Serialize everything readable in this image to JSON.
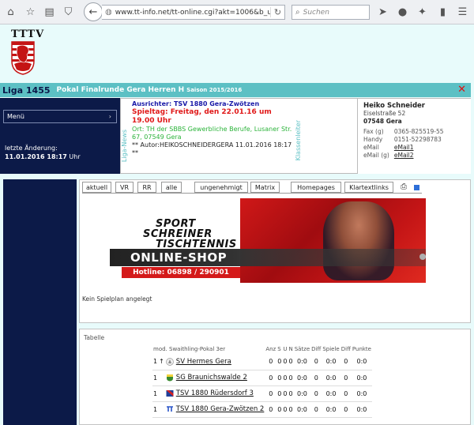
{
  "browser": {
    "url": "www.tt-info.net/tt-online.cgi?akt=1006&b_u",
    "search_placeholder": "Suchen"
  },
  "logo": {
    "text": "TTTV"
  },
  "league": {
    "number": "Liga 1455",
    "competition": "Pokal Finalrunde Gera Herren H",
    "season": "Saison 2015/2016"
  },
  "sidebar": {
    "menu_label": "Menü",
    "last_change_label": "letzte Änderung:",
    "last_change_date": "11.01.2016 18:17",
    "last_change_unit": "Uhr"
  },
  "news": {
    "vertical_label": "Liga-News",
    "ausrichter": "Ausrichter: TSV 1880 Gera-Zwötzen",
    "spieltag": "Spieltag: Freitag, den 22.01.16 um 19.00 Uhr",
    "ort": "Ort: TH der SBBS Gewerbliche Berufe, Lusaner Str. 67, 07549 Gera",
    "autor": "** Autor:HEIKOSCHNEIDERGERA 11.01.2016 18:17 **"
  },
  "contact": {
    "vertical_label": "Klassenleiter",
    "name": "Heiko Schneider",
    "street": "Eiselstraße 52",
    "city": "07548 Gera",
    "rows": [
      {
        "label": "Fax (g)",
        "value": "0365-825519-55"
      },
      {
        "label": "Handy",
        "value": "0151-52298783"
      },
      {
        "label": "eMail",
        "value": "eMail1"
      },
      {
        "label": "eMail (g)",
        "value": "eMail2"
      }
    ]
  },
  "tabs": [
    "aktuell",
    "VR",
    "RR",
    "alle",
    "ungenehmigt",
    "Matrix",
    "Homepages",
    "Klartextlinks"
  ],
  "ad": {
    "line1": "SPORT",
    "line2": "SCHREINER",
    "line3": "TISCHTENNIS",
    "shop": "ONLINE-SHOP",
    "hotline": "Hotline: 06898 / 290901"
  },
  "schedule": {
    "empty_text": "Kein Spielplan angelegt"
  },
  "table": {
    "title": "Tabelle",
    "headers": [
      "mod. Swaithling-Pokal 3er",
      "Anz",
      "S",
      "U",
      "N",
      "Sätze",
      "Diff",
      "Spiele",
      "Diff",
      "Punkte"
    ],
    "rows": [
      {
        "rank": "1",
        "arrow": "↑",
        "team": "SV Hermes Gera",
        "anz": "0",
        "s": "0",
        "u": "0",
        "n": "0",
        "saetze": "0:0",
        "diff": "0",
        "spiele": "0:0",
        "diff2": "0",
        "punkte": "0:0"
      },
      {
        "rank": "1",
        "arrow": "",
        "team": "SG Braunichswalde 2",
        "anz": "0",
        "s": "0",
        "u": "0",
        "n": "0",
        "saetze": "0:0",
        "diff": "0",
        "spiele": "0:0",
        "diff2": "0",
        "punkte": "0:0"
      },
      {
        "rank": "1",
        "arrow": "",
        "team": "TSV 1880 Rüdersdorf 3",
        "anz": "0",
        "s": "0",
        "u": "0",
        "n": "0",
        "saetze": "0:0",
        "diff": "0",
        "spiele": "0:0",
        "diff2": "0",
        "punkte": "0:0"
      },
      {
        "rank": "1",
        "arrow": "",
        "team": "TSV 1880 Gera-Zwötzen 2",
        "anz": "0",
        "s": "0",
        "u": "0",
        "n": "0",
        "saetze": "0:0",
        "diff": "0",
        "spiele": "0:0",
        "diff2": "0",
        "punkte": "0:0"
      }
    ]
  }
}
